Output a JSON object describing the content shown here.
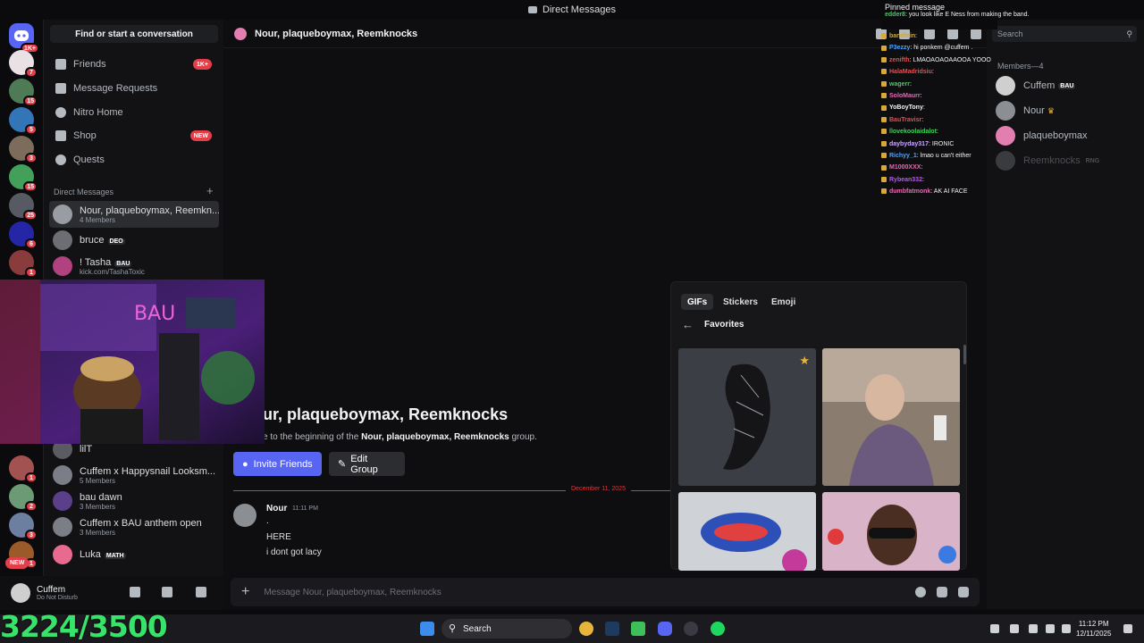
{
  "titlebar": {
    "title": "Direct Messages"
  },
  "sidebar": {
    "find_placeholder": "Find or start a conversation",
    "nav": [
      {
        "label": "Friends",
        "badge": "1K+"
      },
      {
        "label": "Message Requests",
        "badge": ""
      },
      {
        "label": "Nitro Home",
        "badge": ""
      },
      {
        "label": "Shop",
        "badge": "NEW"
      },
      {
        "label": "Quests",
        "badge": ""
      }
    ],
    "dm_header": "Direct Messages",
    "dms": [
      {
        "name": "Nour, plaqueboymax, Reemkn...",
        "sub": "4 Members"
      },
      {
        "name": "bruce",
        "tag": "DEO",
        "sub": ""
      },
      {
        "name": "! Tasha",
        "tag": "BAU",
        "sub": "kick.com/TashaToxic"
      },
      {
        "name": "lilT",
        "sub": ""
      },
      {
        "name": "Cuffem x Happysnail Looksm...",
        "sub": "5 Members"
      },
      {
        "name": "bau dawn",
        "sub": "3 Members"
      },
      {
        "name": "Cuffem x BAU anthem open",
        "sub": "3 Members"
      },
      {
        "name": "Luka",
        "tag": "MATH",
        "sub": ""
      }
    ]
  },
  "rail": {
    "badges": [
      "1K+",
      "7",
      "15",
      "5",
      "3",
      "15",
      "25",
      "6",
      "1",
      "1",
      "2",
      "3",
      "1"
    ],
    "new_label": "NEW"
  },
  "user": {
    "name": "Cuffem",
    "status": "Do Not Disturb"
  },
  "chat": {
    "header_title": "Nour, plaqueboymax, Reemknocks",
    "welcome_title": "ur, plaqueboymax, Reemknocks",
    "welcome_pre": "e to the beginning of the ",
    "welcome_bold": "Nour, plaqueboymax, Reemknocks",
    "welcome_post": " group.",
    "invite_label": "Invite Friends",
    "edit_label": "Edit Group",
    "date_separator": "December 11, 2025",
    "message": {
      "author": "Nour",
      "time": "11:11 PM",
      "lines": [
        ".",
        "HERE",
        "i dont got lacy"
      ]
    },
    "composer_placeholder": "Message Nour, plaqueboymax, Reemknocks"
  },
  "members": {
    "search_placeholder": "Search",
    "header": "Members—4",
    "list": [
      {
        "name": "Cuffem",
        "tag": "BAU",
        "online": true
      },
      {
        "name": "Nour",
        "tag": "♛",
        "online": true
      },
      {
        "name": "plaqueboymax",
        "tag": "",
        "online": true
      },
      {
        "name": "Reemknocks",
        "tag": "RNG",
        "online": false
      }
    ]
  },
  "overlay": {
    "pinned": "Pinned message",
    "pinned_msg": {
      "user": "edder8",
      "text": "you look like E Ness from making the band."
    },
    "rows": [
      {
        "user": "bandfein",
        "text": "",
        "color": "#c9a845"
      },
      {
        "user": "P3ezzy",
        "text": "hi ponkem @cuffem .",
        "color": "#4aa3ff"
      },
      {
        "user": "zenifth",
        "text": "LMAOAOAOAAOOA YOOO",
        "color": "#e05151"
      },
      {
        "user": "HalaMadridsiu",
        "text": "",
        "color": "#e05151"
      },
      {
        "user": "wagerr",
        "text": "",
        "color": "#3fd15a"
      },
      {
        "user": "SoloMaurr",
        "text": "",
        "color": "#e06bb2"
      },
      {
        "user": "YoBoyTony",
        "text": "",
        "color": "#f2f3f5"
      },
      {
        "user": "BauTravisr",
        "text": "",
        "color": "#e05151"
      },
      {
        "user": "llovekoolaidalot",
        "text": "",
        "color": "#3fd15a"
      },
      {
        "user": "daybyday317",
        "text": "IRONIC",
        "color": "#c9a8ff"
      },
      {
        "user": "Richyy_1",
        "text": "lmao u can't either",
        "color": "#4aa3ff"
      },
      {
        "user": "M1000XXX",
        "text": "",
        "color": "#e06bb2"
      },
      {
        "user": "Rybean332",
        "text": "",
        "color": "#b05ee0"
      },
      {
        "user": "dumbfatmonk",
        "text": "AK AI FACE",
        "color": "#e06bb2"
      }
    ]
  },
  "picker": {
    "tabs": [
      "GIFs",
      "Stickers",
      "Emoji"
    ],
    "section": "Favorites"
  },
  "taskbar": {
    "counter": "3224/3500",
    "search": "Search",
    "time": "11:12 PM",
    "date": "12/11/2025"
  }
}
